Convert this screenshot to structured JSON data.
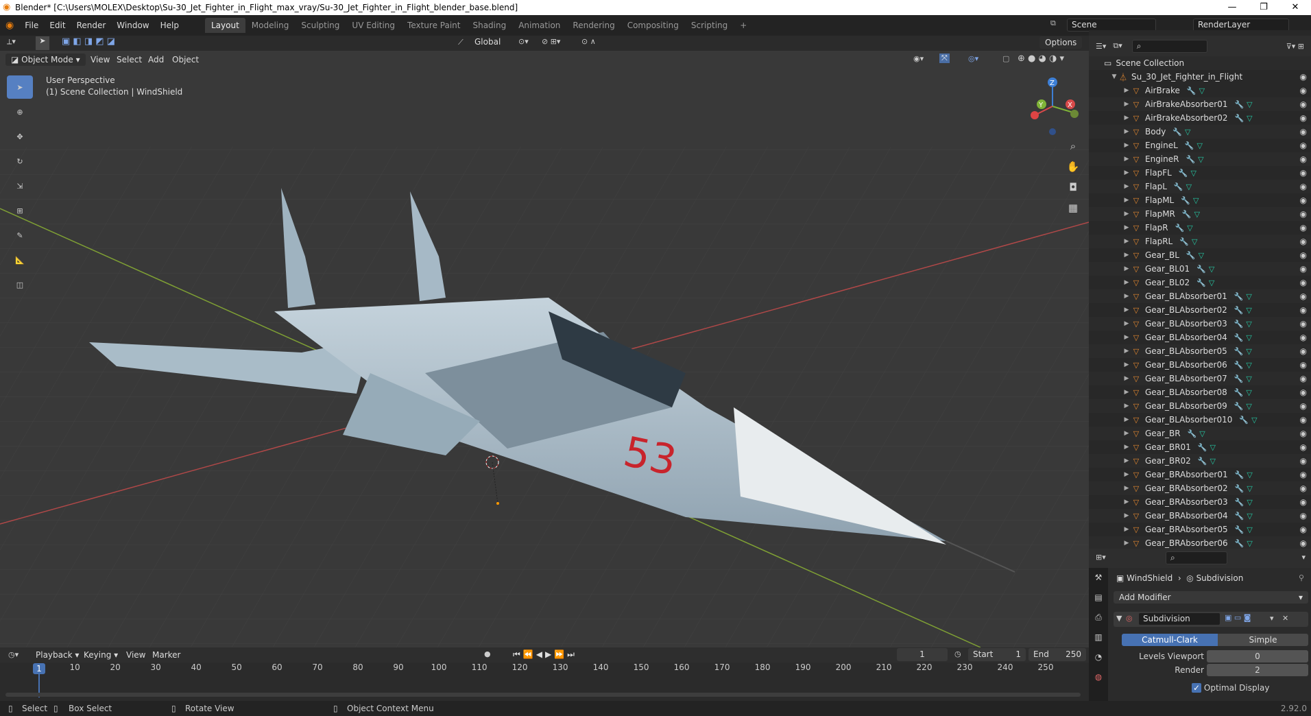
{
  "window": {
    "title": "Blender* [C:\\Users\\MOLEX\\Desktop\\Su-30_Jet_Fighter_in_Flight_max_vray/Su-30_Jet_Fighter_in_Flight_blender_base.blend]"
  },
  "menus": [
    "File",
    "Edit",
    "Render",
    "Window",
    "Help"
  ],
  "workspaces": [
    "Layout",
    "Modeling",
    "Sculpting",
    "UV Editing",
    "Texture Paint",
    "Shading",
    "Animation",
    "Rendering",
    "Compositing",
    "Scripting"
  ],
  "active_workspace": "Layout",
  "scene": "Scene",
  "render_layer": "RenderLayer",
  "header": {
    "orientation": "Global",
    "options": "Options",
    "mode": "Object Mode",
    "menus": [
      "View",
      "Select",
      "Add",
      "Object"
    ]
  },
  "viewport": {
    "perspective": "User Perspective",
    "collection_info": "(1) Scene Collection | WindShield",
    "marking": "53"
  },
  "gizmo": {
    "x": "X",
    "y": "Y",
    "z": "Z"
  },
  "outliner": {
    "root": "Scene Collection",
    "collection": "Su_30_Jet_Fighter_in_Flight",
    "items": [
      "AirBrake",
      "AirBrakeAbsorber01",
      "AirBrakeAbsorber02",
      "Body",
      "EngineL",
      "EngineR",
      "FlapFL",
      "FlapL",
      "FlapML",
      "FlapMR",
      "FlapR",
      "FlapRL",
      "Gear_BL",
      "Gear_BL01",
      "Gear_BL02",
      "Gear_BLAbsorber01",
      "Gear_BLAbsorber02",
      "Gear_BLAbsorber03",
      "Gear_BLAbsorber04",
      "Gear_BLAbsorber05",
      "Gear_BLAbsorber06",
      "Gear_BLAbsorber07",
      "Gear_BLAbsorber08",
      "Gear_BLAbsorber09",
      "Gear_BLAbsorber010",
      "Gear_BR",
      "Gear_BR01",
      "Gear_BR02",
      "Gear_BRAbsorber01",
      "Gear_BRAbsorber02",
      "Gear_BRAbsorber03",
      "Gear_BRAbsorber04",
      "Gear_BRAbsorber05",
      "Gear_BRAbsorber06"
    ]
  },
  "properties": {
    "object": "WindShield",
    "modifier_crumb": "Subdivision",
    "add_modifier": "Add Modifier",
    "modifier_name": "Subdivision",
    "catmull": "Catmull-Clark",
    "simple": "Simple",
    "levels_label": "Levels Viewport",
    "levels_value": "0",
    "render_label": "Render",
    "render_value": "2",
    "optimal": "Optimal Display"
  },
  "timeline": {
    "menus": [
      "Playback",
      "Keying",
      "View",
      "Marker"
    ],
    "current_frame": "1",
    "start_label": "Start",
    "start": "1",
    "end_label": "End",
    "end": "250",
    "ticks": [
      "10",
      "20",
      "30",
      "40",
      "50",
      "60",
      "70",
      "80",
      "90",
      "100",
      "110",
      "120",
      "130",
      "140",
      "150",
      "160",
      "170",
      "180",
      "190",
      "200",
      "210",
      "220",
      "230",
      "240",
      "250"
    ]
  },
  "status": {
    "select": "Select",
    "box_select": "Box Select",
    "rotate": "Rotate View",
    "context": "Object Context Menu",
    "version": "2.92.0"
  }
}
